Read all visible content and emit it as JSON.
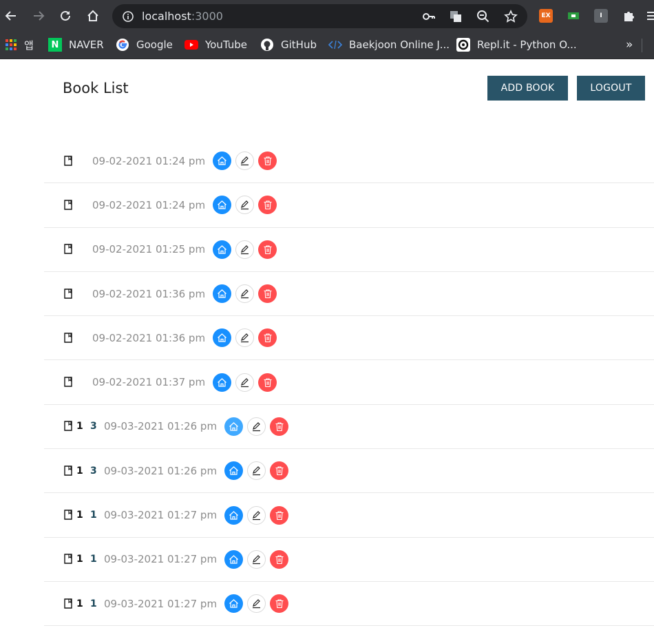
{
  "browser": {
    "url_host": "localhost",
    "url_port": ":3000",
    "extensions": [
      {
        "name": "ex-extension-icon",
        "label": "EX",
        "color": "#e8681d"
      },
      {
        "name": "green-extension-icon",
        "label": "",
        "color": "#2b9c3f"
      },
      {
        "name": "gray-extension-icon",
        "label": "I",
        "color": "#5f6368"
      }
    ],
    "bookmarks": [
      {
        "name": "bookmark-apps",
        "label": "앱",
        "icon": "apps-grid-icon"
      },
      {
        "name": "bookmark-naver",
        "label": "NAVER",
        "icon": "naver-icon"
      },
      {
        "name": "bookmark-google",
        "label": "Google",
        "icon": "google-icon"
      },
      {
        "name": "bookmark-youtube",
        "label": "YouTube",
        "icon": "youtube-icon"
      },
      {
        "name": "bookmark-github",
        "label": "GitHub",
        "icon": "github-icon"
      },
      {
        "name": "bookmark-baekjoon",
        "label": "Baekjoon Online J...",
        "icon": "code-icon"
      },
      {
        "name": "bookmark-replit",
        "label": "Repl.it - Python O...",
        "icon": "replit-icon"
      }
    ],
    "bookmarks_overflow": "»"
  },
  "page": {
    "title": "Book List",
    "add_button": "ADD BOOK",
    "logout_button": "LOGOUT"
  },
  "books": [
    {
      "num_a": "",
      "num_b": "",
      "date": "09-02-2021 01:24 pm"
    },
    {
      "num_a": "",
      "num_b": "",
      "date": "09-02-2021 01:24 pm"
    },
    {
      "num_a": "",
      "num_b": "",
      "date": "09-02-2021 01:25 pm"
    },
    {
      "num_a": "",
      "num_b": "",
      "date": "09-02-2021 01:36 pm"
    },
    {
      "num_a": "",
      "num_b": "",
      "date": "09-02-2021 01:36 pm"
    },
    {
      "num_a": "",
      "num_b": "",
      "date": "09-02-2021 01:37 pm"
    },
    {
      "num_a": "1",
      "num_b": "3",
      "date": "09-03-2021 01:26 pm",
      "home_light": true
    },
    {
      "num_a": "1",
      "num_b": "3",
      "date": "09-03-2021 01:26 pm"
    },
    {
      "num_a": "1",
      "num_b": "1",
      "date": "09-03-2021 01:27 pm"
    },
    {
      "num_a": "1",
      "num_b": "1",
      "date": "09-03-2021 01:27 pm"
    },
    {
      "num_a": "1",
      "num_b": "1",
      "date": "09-03-2021 01:27 pm"
    }
  ],
  "colors": {
    "primary_button": "#295468",
    "home_action": "#1890ff",
    "delete_action": "#ff4d4f"
  }
}
